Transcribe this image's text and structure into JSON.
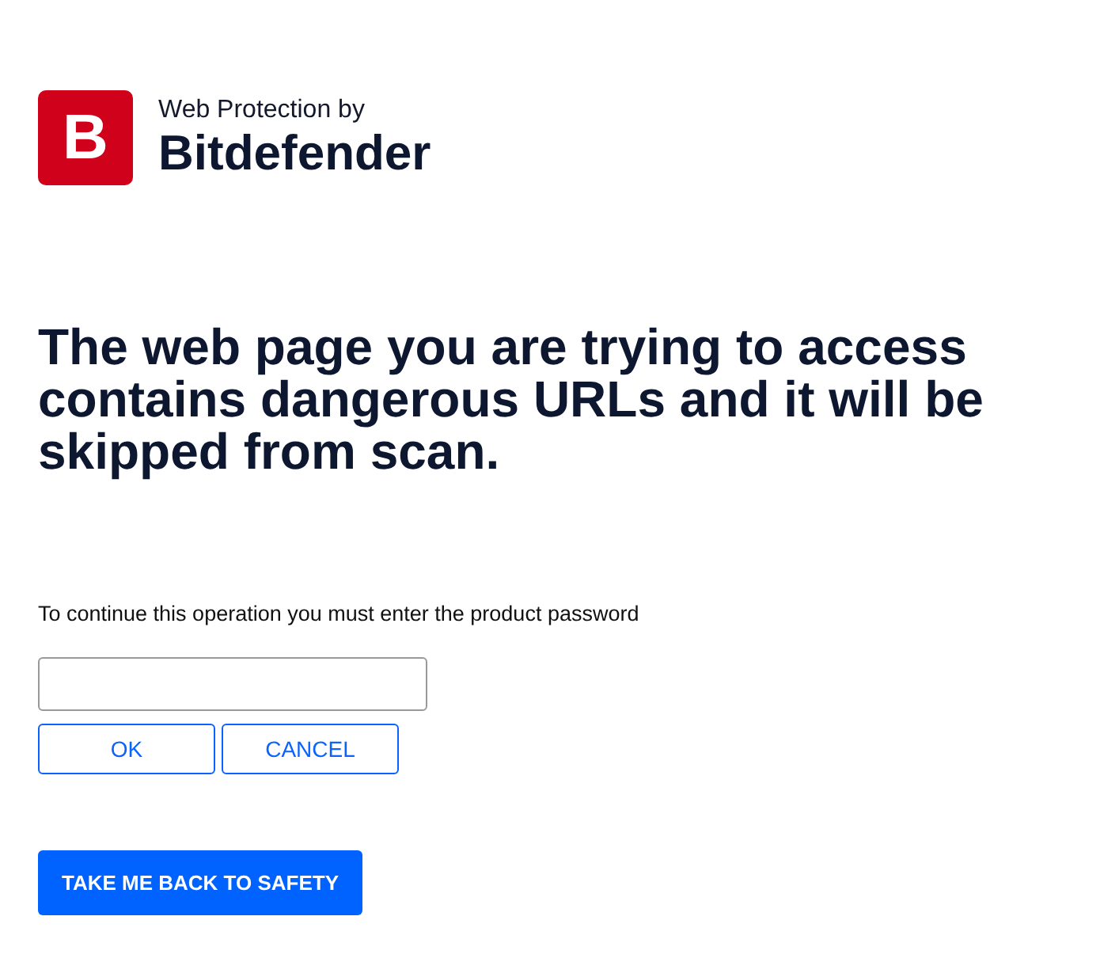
{
  "brand": {
    "logo_letter": "B",
    "tagline": "Web Protection by",
    "name": "Bitdefender"
  },
  "heading": "The web page you are trying to access contains dangerous URLs and it will be skipped from scan.",
  "password_prompt": {
    "label": "To continue this operation you must enter the product password",
    "buttons": [
      {
        "label": "OK"
      },
      {
        "label": "CANCEL"
      }
    ]
  },
  "safety_button": "TAKE ME BACK TO SAFETY"
}
